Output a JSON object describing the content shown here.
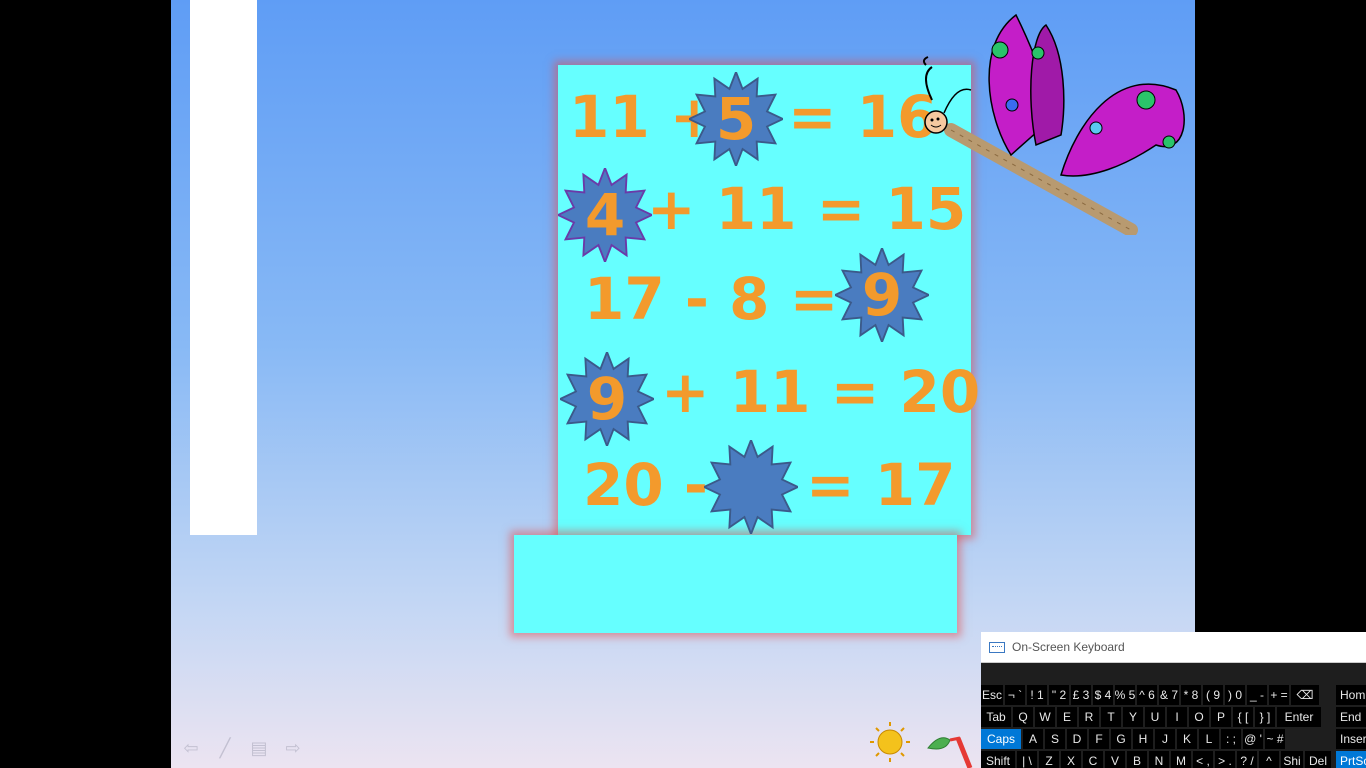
{
  "slide": {
    "equations": [
      {
        "left": "11 +",
        "answer": "5",
        "right": "= 16",
        "star_left": true
      },
      {
        "left": "",
        "answer": "4",
        "right": "+ 11 = 15"
      },
      {
        "left": "17 -  8  =",
        "answer": "9",
        "right": ""
      },
      {
        "left": "",
        "answer": "9",
        "right": "+ 11 = 20"
      },
      {
        "left": "20 -",
        "answer": "",
        "right": "= 17"
      }
    ],
    "text_color": "#f39a2c",
    "star_color": "#4a7cc0",
    "card_color": "#66ffff",
    "nav_icons": [
      "back-arrow-icon",
      "pen-icon",
      "menu-icon",
      "forward-arrow-icon"
    ]
  },
  "osk": {
    "title": "On-Screen Keyboard",
    "row1": [
      "Esc",
      "¬ `",
      "! 1",
      "\" 2",
      "£ 3",
      "$ 4",
      "% 5",
      "^ 6",
      "& 7",
      "* 8",
      "( 9",
      ") 0",
      "_ -",
      "+ =",
      "⌫"
    ],
    "row2": [
      "Tab",
      "Q",
      "W",
      "E",
      "R",
      "T",
      "Y",
      "U",
      "I",
      "O",
      "P",
      "{ [",
      "} ]",
      "Enter"
    ],
    "row3": [
      "Caps",
      "A",
      "S",
      "D",
      "F",
      "G",
      "H",
      "J",
      "K",
      "L",
      ": ;",
      "@ '",
      "~ #"
    ],
    "row4": [
      "Shift",
      "| \\",
      "Z",
      "X",
      "C",
      "V",
      "B",
      "N",
      "M",
      "< ,",
      "> .",
      "? /",
      "^",
      "Shi",
      "Del"
    ],
    "side": [
      "Hom",
      "End",
      "Inser",
      "PrtSc"
    ]
  }
}
